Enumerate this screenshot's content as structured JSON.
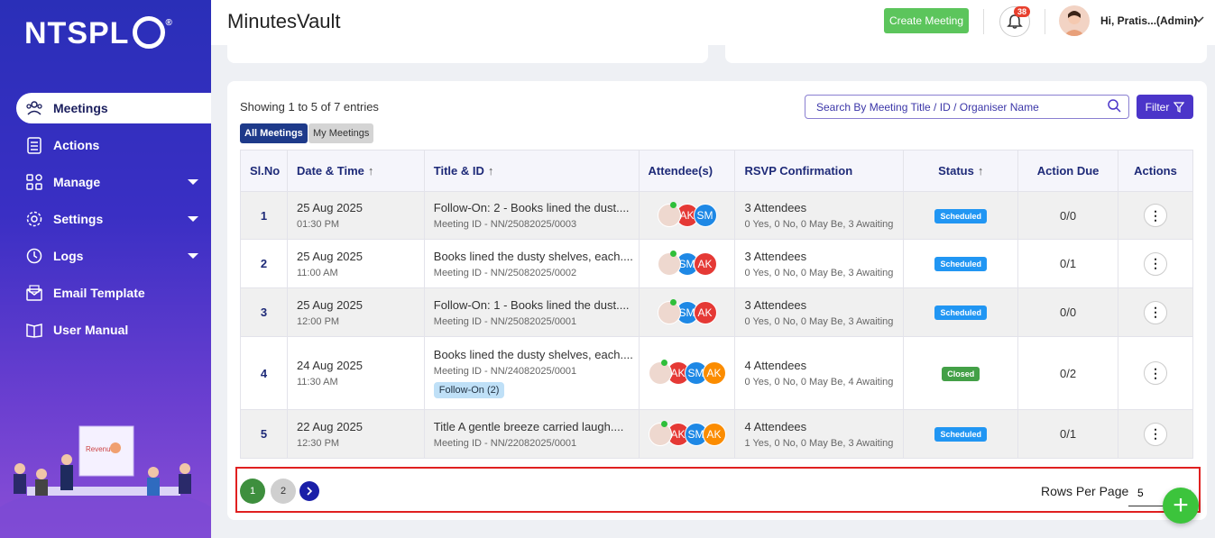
{
  "sidebar": {
    "logo_text": "NTSPL",
    "logo_reg": "®",
    "items": [
      {
        "label": "Meetings",
        "icon": "meetings-icon"
      },
      {
        "label": "Actions",
        "icon": "actions-icon"
      },
      {
        "label": "Manage",
        "icon": "manage-icon"
      },
      {
        "label": "Settings",
        "icon": "settings-icon"
      },
      {
        "label": "Logs",
        "icon": "logs-icon"
      },
      {
        "label": "Email Template",
        "icon": "email-template-icon"
      },
      {
        "label": "User Manual",
        "icon": "user-manual-icon"
      }
    ],
    "illustration_text": "Revenue"
  },
  "header": {
    "title": "MinutesVault",
    "create_label": "Create Meeting",
    "notification_count": "38",
    "user_greeting": "Hi, Pratis...(Admin)"
  },
  "main": {
    "entries_text": "Showing 1 to 5 of 7 entries",
    "tabs": [
      "All Meetings",
      "My Meetings"
    ],
    "search_placeholder": "Search By Meeting Title / ID / Organiser Name",
    "filter_label": "Filter",
    "columns": [
      "Sl.No",
      "Date & Time",
      "Title & ID",
      "Attendee(s)",
      "RSVP Confirmation",
      "Status",
      "Action Due",
      "Actions"
    ],
    "rows": [
      {
        "sl": "1",
        "date": "25 Aug 2025",
        "time": "01:30 PM",
        "title": "Follow-On: 2 - Books lined the dust....",
        "meeting_id": "Meeting ID - NN/25082025/0003",
        "follow_on": "",
        "attendees": [
          "AK",
          "SM"
        ],
        "rsvp": "3 Attendees",
        "rsvp_detail": "0 Yes, 0 No, 0 May Be, 3 Awaiting",
        "status": "Scheduled",
        "due": "0/0"
      },
      {
        "sl": "2",
        "date": "25 Aug 2025",
        "time": "11:00 AM",
        "title": "Books lined the dusty shelves, each....",
        "meeting_id": "Meeting ID - NN/25082025/0002",
        "follow_on": "",
        "attendees": [
          "SM",
          "AK"
        ],
        "rsvp": "3 Attendees",
        "rsvp_detail": "0 Yes, 0 No, 0 May Be, 3 Awaiting",
        "status": "Scheduled",
        "due": "0/1"
      },
      {
        "sl": "3",
        "date": "25 Aug 2025",
        "time": "12:00 PM",
        "title": "Follow-On: 1 - Books lined the dust....",
        "meeting_id": "Meeting ID - NN/25082025/0001",
        "follow_on": "",
        "attendees": [
          "SM",
          "AK"
        ],
        "rsvp": "3 Attendees",
        "rsvp_detail": "0 Yes, 0 No, 0 May Be, 3 Awaiting",
        "status": "Scheduled",
        "due": "0/0"
      },
      {
        "sl": "4",
        "date": "24 Aug 2025",
        "time": "11:30 AM",
        "title": "Books lined the dusty shelves, each....",
        "meeting_id": "Meeting ID - NN/24082025/0001",
        "follow_on": "Follow-On (2)",
        "attendees": [
          "AK",
          "SM",
          "AK"
        ],
        "rsvp": "4 Attendees",
        "rsvp_detail": "0 Yes, 0 No, 0 May Be, 4 Awaiting",
        "status": "Closed",
        "due": "0/2"
      },
      {
        "sl": "5",
        "date": "22 Aug 2025",
        "time": "12:30 PM",
        "title": "Title A gentle breeze carried laugh....",
        "meeting_id": "Meeting ID - NN/22082025/0001",
        "follow_on": "",
        "attendees": [
          "AK",
          "SM",
          "AK"
        ],
        "rsvp": "4 Attendees",
        "rsvp_detail": "1 Yes, 0 No, 0 May Be, 3 Awaiting",
        "status": "Scheduled",
        "due": "0/1"
      }
    ],
    "colors": {
      "AK": "#e53935",
      "SM": "#1e88e5",
      "AK3": "#fb8c00",
      "Scheduled": "#2196f3",
      "Closed": "#43a047"
    }
  },
  "pagination": {
    "pages": [
      "1",
      "2"
    ],
    "rows_label": "Rows Per Page",
    "rows_value": "5"
  }
}
